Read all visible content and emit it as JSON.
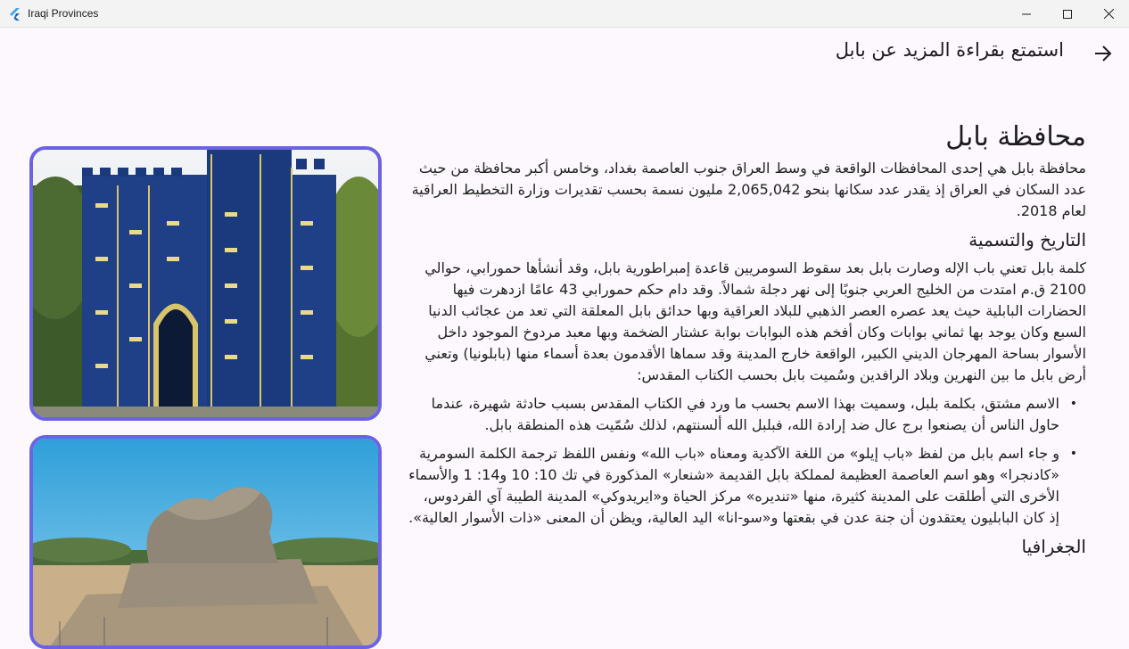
{
  "window": {
    "title": "Iraqi Provinces"
  },
  "appbar": {
    "title": "استمتع بقراءة المزيد عن بابل",
    "back_icon": "arrow-right-icon"
  },
  "images": [
    {
      "name": "ishtar-gate"
    },
    {
      "name": "lion-of-babylon"
    }
  ],
  "article": {
    "heading": "محافظة بابل",
    "intro": "محافظة بابل هي إحدى المحافظات الواقعة في وسط العراق جنوب العاصمة بغداد، وخامس أكبر محافظة من حيث عدد السكان في العراق إذ يقدر عدد سكانها بنحو 2,065,042 مليون نسمة بحسب تقديرات وزارة التخطيط العراقية لعام 2018.",
    "history_heading": "التاريخ والتسمية",
    "history_text": "كلمة بابل تعني باب الإله وصارت بابل بعد سقوط السومريين قاعدة إمبراطورية بابل، وقد أنشأها حمورابي، حوالي 2100 ق.م امتدت من الخليج العربي جنوبًا إلى نهر دجلة شمالاً. وقد دام حكم حمورابي 43 عامًا ازدهرت فيها الحضارات البابلية حيث يعد عصره العصر الذهبي للبلاد العراقية وبها حدائق بابل المعلقة التي تعد من عجائب الدنيا السبع وكان يوجد بها ثماني بوابات وكان أفخم هذه البوابات بوابة عشتار الضخمة وبها معبد مردوخ الموجود داخل الأسوار بساحة المهرجان الديني الكبير، الواقعة خارج المدينة وقد سماها الأقدمون بعدة أسماء منها (بابلونيا) وتعني أرض بابل ما بين النهرين وبلاد الرافدين وسُميت بابل بحسب الكتاب المقدس:",
    "bullets": [
      "الاسم مشتق، بكلمة بلبل، وسميت بهذا الاسم بحسب ما ورد في الكتاب المقدس بسبب حادثة شهيرة، عندما حاول الناس أن يصنعوا برج عال ضد إرادة الله، فبلبل الله ألسنتهم، لذلك سُمّيت هذه المنطقة بابل.",
      "و جاء اسم بابل من لفظ «باب إيلو» من اللغة الآكدية ومعناه «باب الله» ونفس اللفظ ترجمة الكلمة السومرية «كادنجرا» وهو اسم العاصمة العظيمة لمملكة بابل القديمة «شنعار» المذكورة في تك 10: 10 و14: 1 والأسماء الأخرى التي أطلقت على المدينة كثيرة، منها «تنديره» مركز الحياة و«ايريدوكي» المدينة الطيبة آي الفردوس، إذ كان البابليون يعتقدون أن جنة عدن في بقعتها و«سو-انا» اليد العالية، ويظن أن المعنى «ذات الأسوار العالية»."
    ],
    "geo_heading": "الجغرافيا"
  }
}
